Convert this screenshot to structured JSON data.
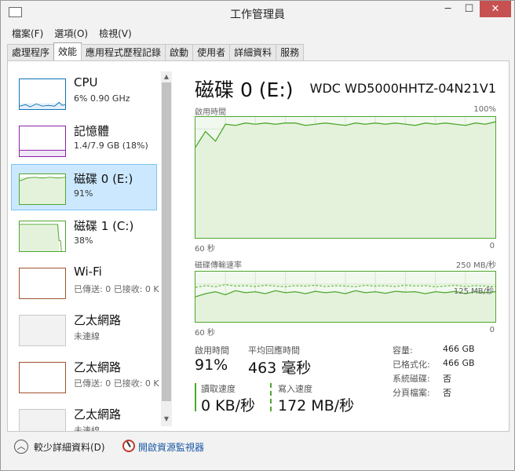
{
  "window": {
    "title": "工作管理員",
    "min": "─",
    "max": "☐",
    "close": "✕"
  },
  "menu": [
    "檔案(F)",
    "選項(O)",
    "檢視(V)"
  ],
  "tabs": [
    {
      "label": "處理程序",
      "active": false
    },
    {
      "label": "效能",
      "active": true
    },
    {
      "label": "應用程式歷程記錄",
      "active": false
    },
    {
      "label": "啟動",
      "active": false
    },
    {
      "label": "使用者",
      "active": false
    },
    {
      "label": "詳細資料",
      "active": false
    },
    {
      "label": "服務",
      "active": false
    }
  ],
  "sidebar": [
    {
      "name": "CPU",
      "sub": "6%  0.90 GHz",
      "color": "#1173b8",
      "selected": false
    },
    {
      "name": "記憶體",
      "sub": "1.4/7.9 GB (18%)",
      "color": "#8b22a8",
      "selected": false
    },
    {
      "name": "磁碟 0 (E:)",
      "sub": "91%",
      "color": "#4ea72e",
      "selected": true
    },
    {
      "name": "磁碟 1 (C:)",
      "sub": "38%",
      "color": "#4ea72e",
      "selected": false
    },
    {
      "name": "Wi-Fi",
      "sub": "已傳送: 0 已接收: 0 K",
      "color": "#a0522d",
      "selected": false
    },
    {
      "name": "乙太網路",
      "sub": "未連線",
      "color": "#bbbbbb",
      "selected": false
    },
    {
      "name": "乙太網路",
      "sub": "已傳送: 0 已接收: 0 K",
      "color": "#a0522d",
      "selected": false
    },
    {
      "name": "乙太網路",
      "sub": "未連線",
      "color": "#bbbbbb",
      "selected": false
    }
  ],
  "main": {
    "title": "磁碟 0 (E:)",
    "model": "WDC WD5000HHTZ-04N21V1",
    "chart1": {
      "label": "啟用時間",
      "max_label": "100%",
      "left_axis": "60 秒",
      "right_axis": "0"
    },
    "chart2": {
      "label": "磁碟傳輸速率",
      "max_label": "250 MB/秒",
      "mid_label": "125 MB/秒",
      "left_axis": "60 秒",
      "right_axis": "0"
    },
    "stats": {
      "active_time_label": "啟用時間",
      "active_time_value": "91%",
      "avg_response_label": "平均回應時間",
      "avg_response_value": "463 毫秒",
      "read_label": "讀取速度",
      "read_value": "0 KB/秒",
      "write_label": "寫入速度",
      "write_value": "172 MB/秒"
    },
    "info": [
      {
        "key": "容量:",
        "value": "466 GB"
      },
      {
        "key": "已格式化:",
        "value": "466 GB"
      },
      {
        "key": "系統磁碟:",
        "value": "否"
      },
      {
        "key": "分頁檔案:",
        "value": "否"
      }
    ]
  },
  "footer": {
    "fewer_details": "較少詳細資料(D)",
    "resource_monitor": "開啟資源監視器"
  },
  "chart_data": [
    {
      "type": "line",
      "title": "啟用時間",
      "ylim": [
        0,
        100
      ],
      "x": [
        60,
        58,
        56,
        54,
        52,
        50,
        48,
        46,
        44,
        42,
        40,
        38,
        36,
        34,
        32,
        30,
        28,
        26,
        24,
        22,
        20,
        18,
        16,
        14,
        12,
        10,
        8,
        6,
        4,
        2,
        0
      ],
      "series": [
        {
          "values": [
            75,
            88,
            80,
            94,
            93,
            95,
            94,
            95,
            94,
            95,
            95,
            93,
            94,
            95,
            94,
            93,
            95,
            94,
            95,
            94,
            95,
            94,
            93,
            95,
            94,
            95,
            94,
            93,
            95,
            94,
            96
          ]
        }
      ]
    },
    {
      "type": "line",
      "title": "磁碟傳輸速率",
      "ylim": [
        0,
        250
      ],
      "x": [
        60,
        58,
        56,
        54,
        52,
        50,
        48,
        46,
        44,
        42,
        40,
        38,
        36,
        34,
        32,
        30,
        28,
        26,
        24,
        22,
        20,
        18,
        16,
        14,
        12,
        10,
        8,
        6,
        4,
        2,
        0
      ],
      "series": [
        {
          "values": [
            125,
            140,
            150,
            135,
            155,
            145,
            150,
            140,
            155,
            145,
            150,
            140,
            152,
            145,
            150,
            140,
            155,
            145,
            150,
            142,
            152,
            148,
            150,
            140,
            150,
            145,
            152,
            140,
            150,
            145,
            150
          ]
        },
        {
          "values": [
            172,
            180,
            175,
            185,
            178,
            180,
            176,
            182,
            178,
            175,
            180,
            178,
            182,
            176,
            180,
            178,
            175,
            182,
            178,
            180,
            176,
            182,
            178,
            180,
            175,
            178,
            182,
            176,
            180,
            178,
            176
          ]
        }
      ]
    }
  ]
}
